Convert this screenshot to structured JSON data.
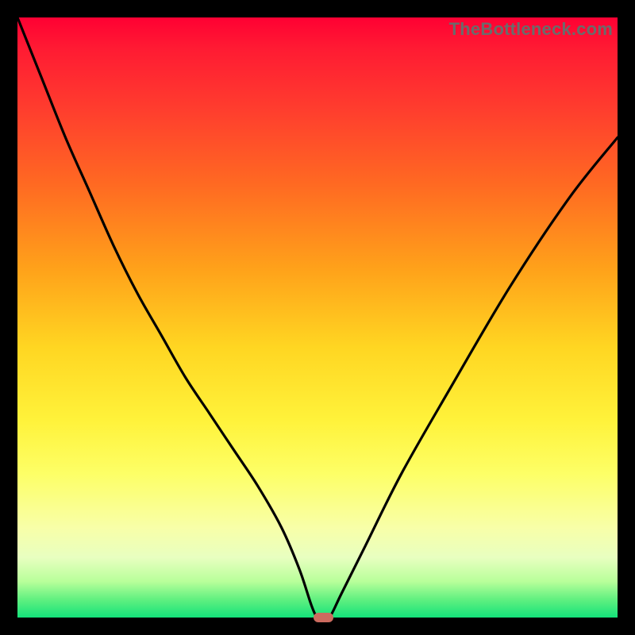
{
  "watermark": "TheBottleneck.com",
  "colors": {
    "frame": "#000000",
    "curve": "#000000",
    "marker": "#cc6b5f"
  },
  "chart_data": {
    "type": "line",
    "title": "",
    "xlabel": "",
    "ylabel": "",
    "xlim": [
      0,
      100
    ],
    "ylim": [
      0,
      100
    ],
    "series": [
      {
        "name": "bottleneck-curve",
        "x": [
          0,
          4,
          8,
          12,
          16,
          20,
          24,
          28,
          32,
          36,
          40,
          44,
          47,
          49,
          50,
          51,
          52,
          54,
          58,
          64,
          72,
          82,
          92,
          100
        ],
        "y": [
          100,
          90,
          80,
          71,
          62,
          54,
          47,
          40,
          34,
          28,
          22,
          15,
          8,
          2,
          0,
          0,
          0,
          4,
          12,
          24,
          38,
          55,
          70,
          80
        ]
      }
    ],
    "marker": {
      "x": 51,
      "y": 0,
      "width_pct": 3.3
    },
    "gradient_stops": [
      {
        "pct": 0,
        "color": "#ff0033"
      },
      {
        "pct": 55,
        "color": "#ffd622"
      },
      {
        "pct": 85,
        "color": "#f8ffa8"
      },
      {
        "pct": 100,
        "color": "#14e27a"
      }
    ]
  }
}
